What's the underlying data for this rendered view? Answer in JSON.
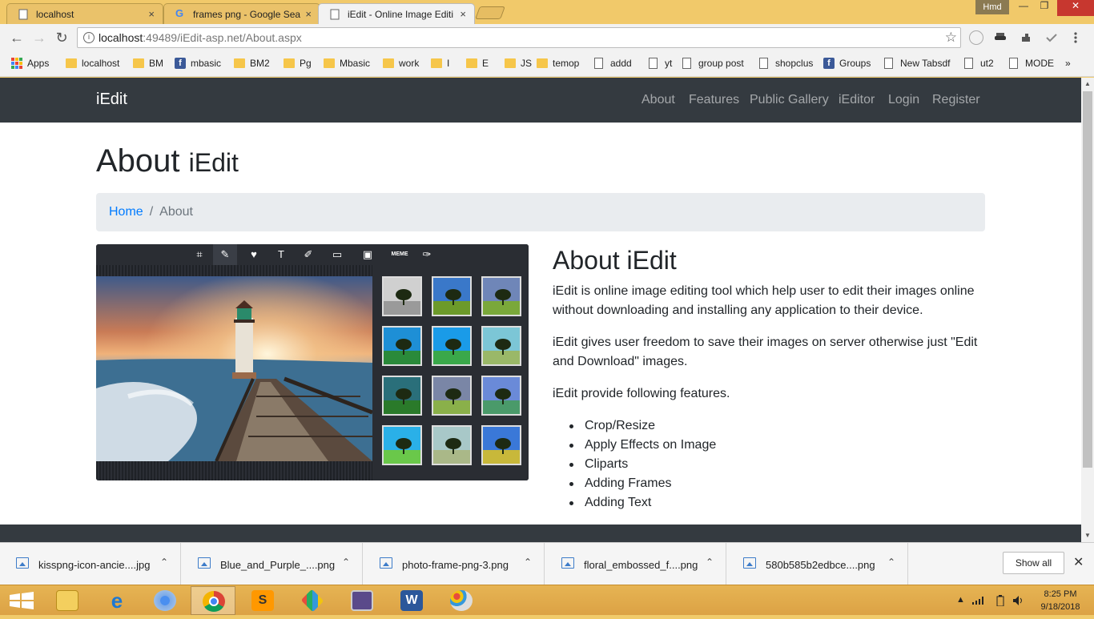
{
  "browser": {
    "tabs": [
      {
        "title": "localhost",
        "close": "×"
      },
      {
        "title": "frames png - Google Sea",
        "close": "×"
      },
      {
        "title": "iEdit - Online Image Editi",
        "close": "×"
      }
    ],
    "user_chip": "Hmd",
    "window_buttons": {
      "minimize": "—",
      "maximize": "❐",
      "close": "✕"
    },
    "address": {
      "host": "localhost",
      "path": ":49489/iEdit-asp.net/About.aspx"
    },
    "nav": {
      "back": "←",
      "forward": "→",
      "reload": "↻",
      "bookmark_star": "☆"
    },
    "bookmarks": [
      {
        "label": "Apps",
        "icon": "apps-grid-icon"
      },
      {
        "label": "localhost",
        "icon": "folder-icon"
      },
      {
        "label": "BM",
        "icon": "folder-icon"
      },
      {
        "label": "mbasic",
        "icon": "facebook-icon"
      },
      {
        "label": "BM2",
        "icon": "folder-icon"
      },
      {
        "label": "Pg",
        "icon": "folder-icon"
      },
      {
        "label": "Mbasic",
        "icon": "folder-icon"
      },
      {
        "label": "work",
        "icon": "folder-icon"
      },
      {
        "label": "I",
        "icon": "folder-icon"
      },
      {
        "label": "E",
        "icon": "folder-icon"
      },
      {
        "label": "JS",
        "icon": "folder-icon"
      },
      {
        "label": "temop",
        "icon": "folder-icon"
      },
      {
        "label": "addd",
        "icon": "page-icon"
      },
      {
        "label": "yt",
        "icon": "page-icon"
      },
      {
        "label": "group post",
        "icon": "page-icon"
      },
      {
        "label": "shopclus",
        "icon": "page-icon"
      },
      {
        "label": "Groups",
        "icon": "facebook-icon"
      },
      {
        "label": "New Tabsdf",
        "icon": "page-icon"
      },
      {
        "label": "ut2",
        "icon": "page-icon"
      },
      {
        "label": "MODE",
        "icon": "page-icon"
      }
    ],
    "bookmarks_overflow": "»"
  },
  "site": {
    "brand": "iEdit",
    "nav_links": [
      "About",
      "Features",
      "Public Gallery",
      "iEditor",
      "Login",
      "Register"
    ],
    "page_title": "About",
    "page_subtitle": "iEdit",
    "breadcrumb": {
      "home": "Home",
      "separator": "/",
      "current": "About"
    },
    "about_heading": "About iEdit",
    "paragraphs": [
      "iEdit is online image editing tool which help user to edit their images online without downloading and installing any application to their device.",
      "iEdit gives user freedom to save their images on server otherwise just \"Edit and Download\" images.",
      "iEdit provide following features."
    ],
    "features": [
      "Crop/Resize",
      "Apply Effects on Image",
      "Cliparts",
      "Adding Frames",
      "Adding Text"
    ],
    "editor_tools": [
      {
        "glyph": "⌗",
        "name": "crop-tool-icon"
      },
      {
        "glyph": "✎",
        "name": "effects-wand-icon"
      },
      {
        "glyph": "♥",
        "name": "clipart-heart-icon"
      },
      {
        "glyph": "T",
        "name": "text-tool-icon"
      },
      {
        "glyph": "✐",
        "name": "draw-tool-icon"
      },
      {
        "glyph": "▭",
        "name": "frame-tool-icon"
      },
      {
        "glyph": "▣",
        "name": "image-tool-icon"
      },
      {
        "glyph": "MEME",
        "name": "meme-tool-icon"
      },
      {
        "glyph": "✑",
        "name": "brush-tool-icon"
      }
    ]
  },
  "downloads": {
    "items": [
      {
        "name": "kisspng-icon-ancie....jpg"
      },
      {
        "name": "Blue_and_Purple_....png"
      },
      {
        "name": "photo-frame-png-3.png"
      },
      {
        "name": "floral_embossed_f....png"
      },
      {
        "name": "580b585b2edbce....png"
      }
    ],
    "chevron": "⌃",
    "show_all": "Show all",
    "close": "✕"
  },
  "taskbar": {
    "time": "8:25 PM",
    "date": "9/18/2018",
    "apps": [
      "start",
      "file-explorer",
      "internet-explorer",
      "chromium",
      "chrome",
      "sublime-text",
      "app-grid",
      "media-viewer",
      "word",
      "paint"
    ]
  },
  "colors": {
    "navbar_bg": "#343a40",
    "link_blue": "#007bff",
    "breadcrumb_bg": "#e9ecef",
    "taskbar": "#dca245",
    "tabstrip": "#f1c96a"
  }
}
